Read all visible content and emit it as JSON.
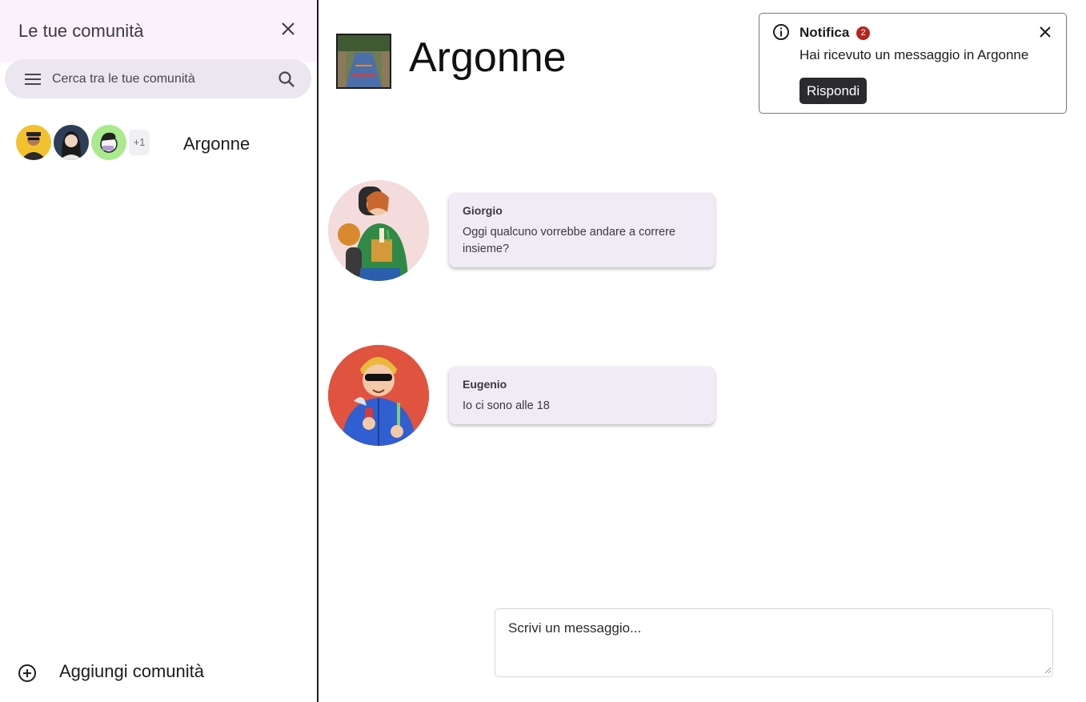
{
  "sidebar": {
    "title": "Le tue comunità",
    "search": {
      "placeholder": "Cerca tra le tue comunità"
    },
    "communities": [
      {
        "name": "Argonne",
        "extra_members": "+1"
      }
    ],
    "add_label": "Aggiungi comunità"
  },
  "room": {
    "title": "Argonne"
  },
  "messages": [
    {
      "author": "Giorgio",
      "text": "Oggi qualcuno vorrebbe andare a correre insieme?"
    },
    {
      "author": "Eugenio",
      "text": "Io ci sono alle 18"
    }
  ],
  "composer": {
    "placeholder": "Scrivi un messaggio..."
  },
  "notification": {
    "title": "Notifica",
    "badge": "2",
    "body": "Hai ricevuto un messaggio in Argonne",
    "action_label": "Rispondi"
  },
  "icons": {
    "close": "close-icon",
    "menu": "menu-icon",
    "search": "search-icon",
    "add": "add-circle-icon",
    "info": "info-icon"
  },
  "colors": {
    "sidebar_header_bg": "#fbf1fd",
    "search_bg": "#ece6f0",
    "bubble_bg": "#f0ebf5",
    "badge": "#b3261e",
    "action_button": "#2b2a2e"
  }
}
